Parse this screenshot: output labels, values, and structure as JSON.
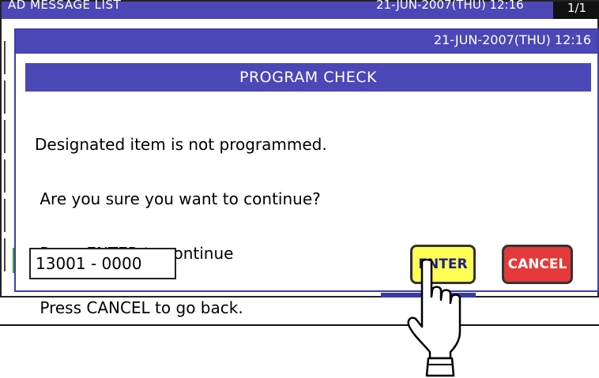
{
  "background": {
    "title": "AD MESSAGE LIST",
    "date": "21-JUN-2007(THU) 12:16",
    "page": "1/1"
  },
  "dialog": {
    "date": "21-JUN-2007(THU) 12:16",
    "title": "PROGRAM CHECK",
    "message_lines": [
      "Designated item is not programmed.",
      " Are you sure you want to continue?",
      " Press ENTER to continue",
      " Press CANCEL to go back."
    ],
    "code": "13001 - 0000",
    "enter_label": "ENTER",
    "cancel_label": "CANCEL"
  },
  "colors": {
    "title_bar": "#4b47b6",
    "enter_button": "#ffff55",
    "cancel_button": "#e53a3a"
  },
  "icons": {
    "pointer": "pointing-hand-icon"
  }
}
